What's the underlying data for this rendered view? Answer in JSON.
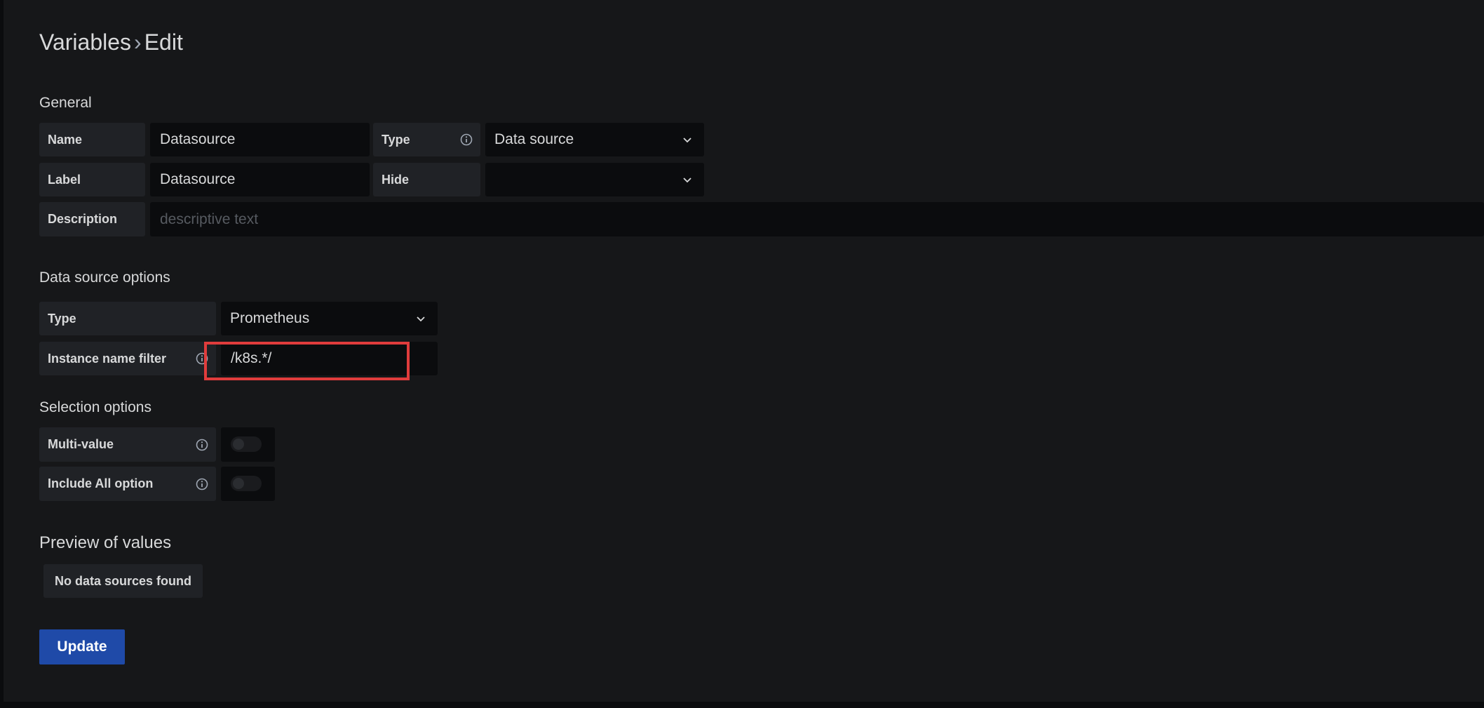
{
  "breadcrumb": {
    "parent": "Variables",
    "separator": "›",
    "current": "Edit"
  },
  "general": {
    "heading": "General",
    "name_label": "Name",
    "name_value": "Datasource",
    "type_label": "Type",
    "type_value": "Data source",
    "label_label": "Label",
    "label_value": "Datasource",
    "hide_label": "Hide",
    "hide_value": "",
    "description_label": "Description",
    "description_placeholder": "descriptive text",
    "description_value": ""
  },
  "datasource_options": {
    "heading": "Data source options",
    "type_label": "Type",
    "type_value": "Prometheus",
    "instance_filter_label": "Instance name filter",
    "instance_filter_value": "/k8s.*/"
  },
  "selection_options": {
    "heading": "Selection options",
    "multi_value_label": "Multi-value",
    "multi_value_enabled": false,
    "include_all_label": "Include All option",
    "include_all_enabled": false
  },
  "preview": {
    "heading": "Preview of values",
    "empty_text": "No data sources found"
  },
  "actions": {
    "update_label": "Update"
  },
  "colors": {
    "background": "#161719",
    "label_bg": "#202226",
    "input_bg": "#0b0c0e",
    "primary": "#1f4aa8",
    "highlight": "#e03c3c"
  },
  "icons": {
    "info": "info-circle-icon",
    "chevron": "chevron-down-icon"
  }
}
